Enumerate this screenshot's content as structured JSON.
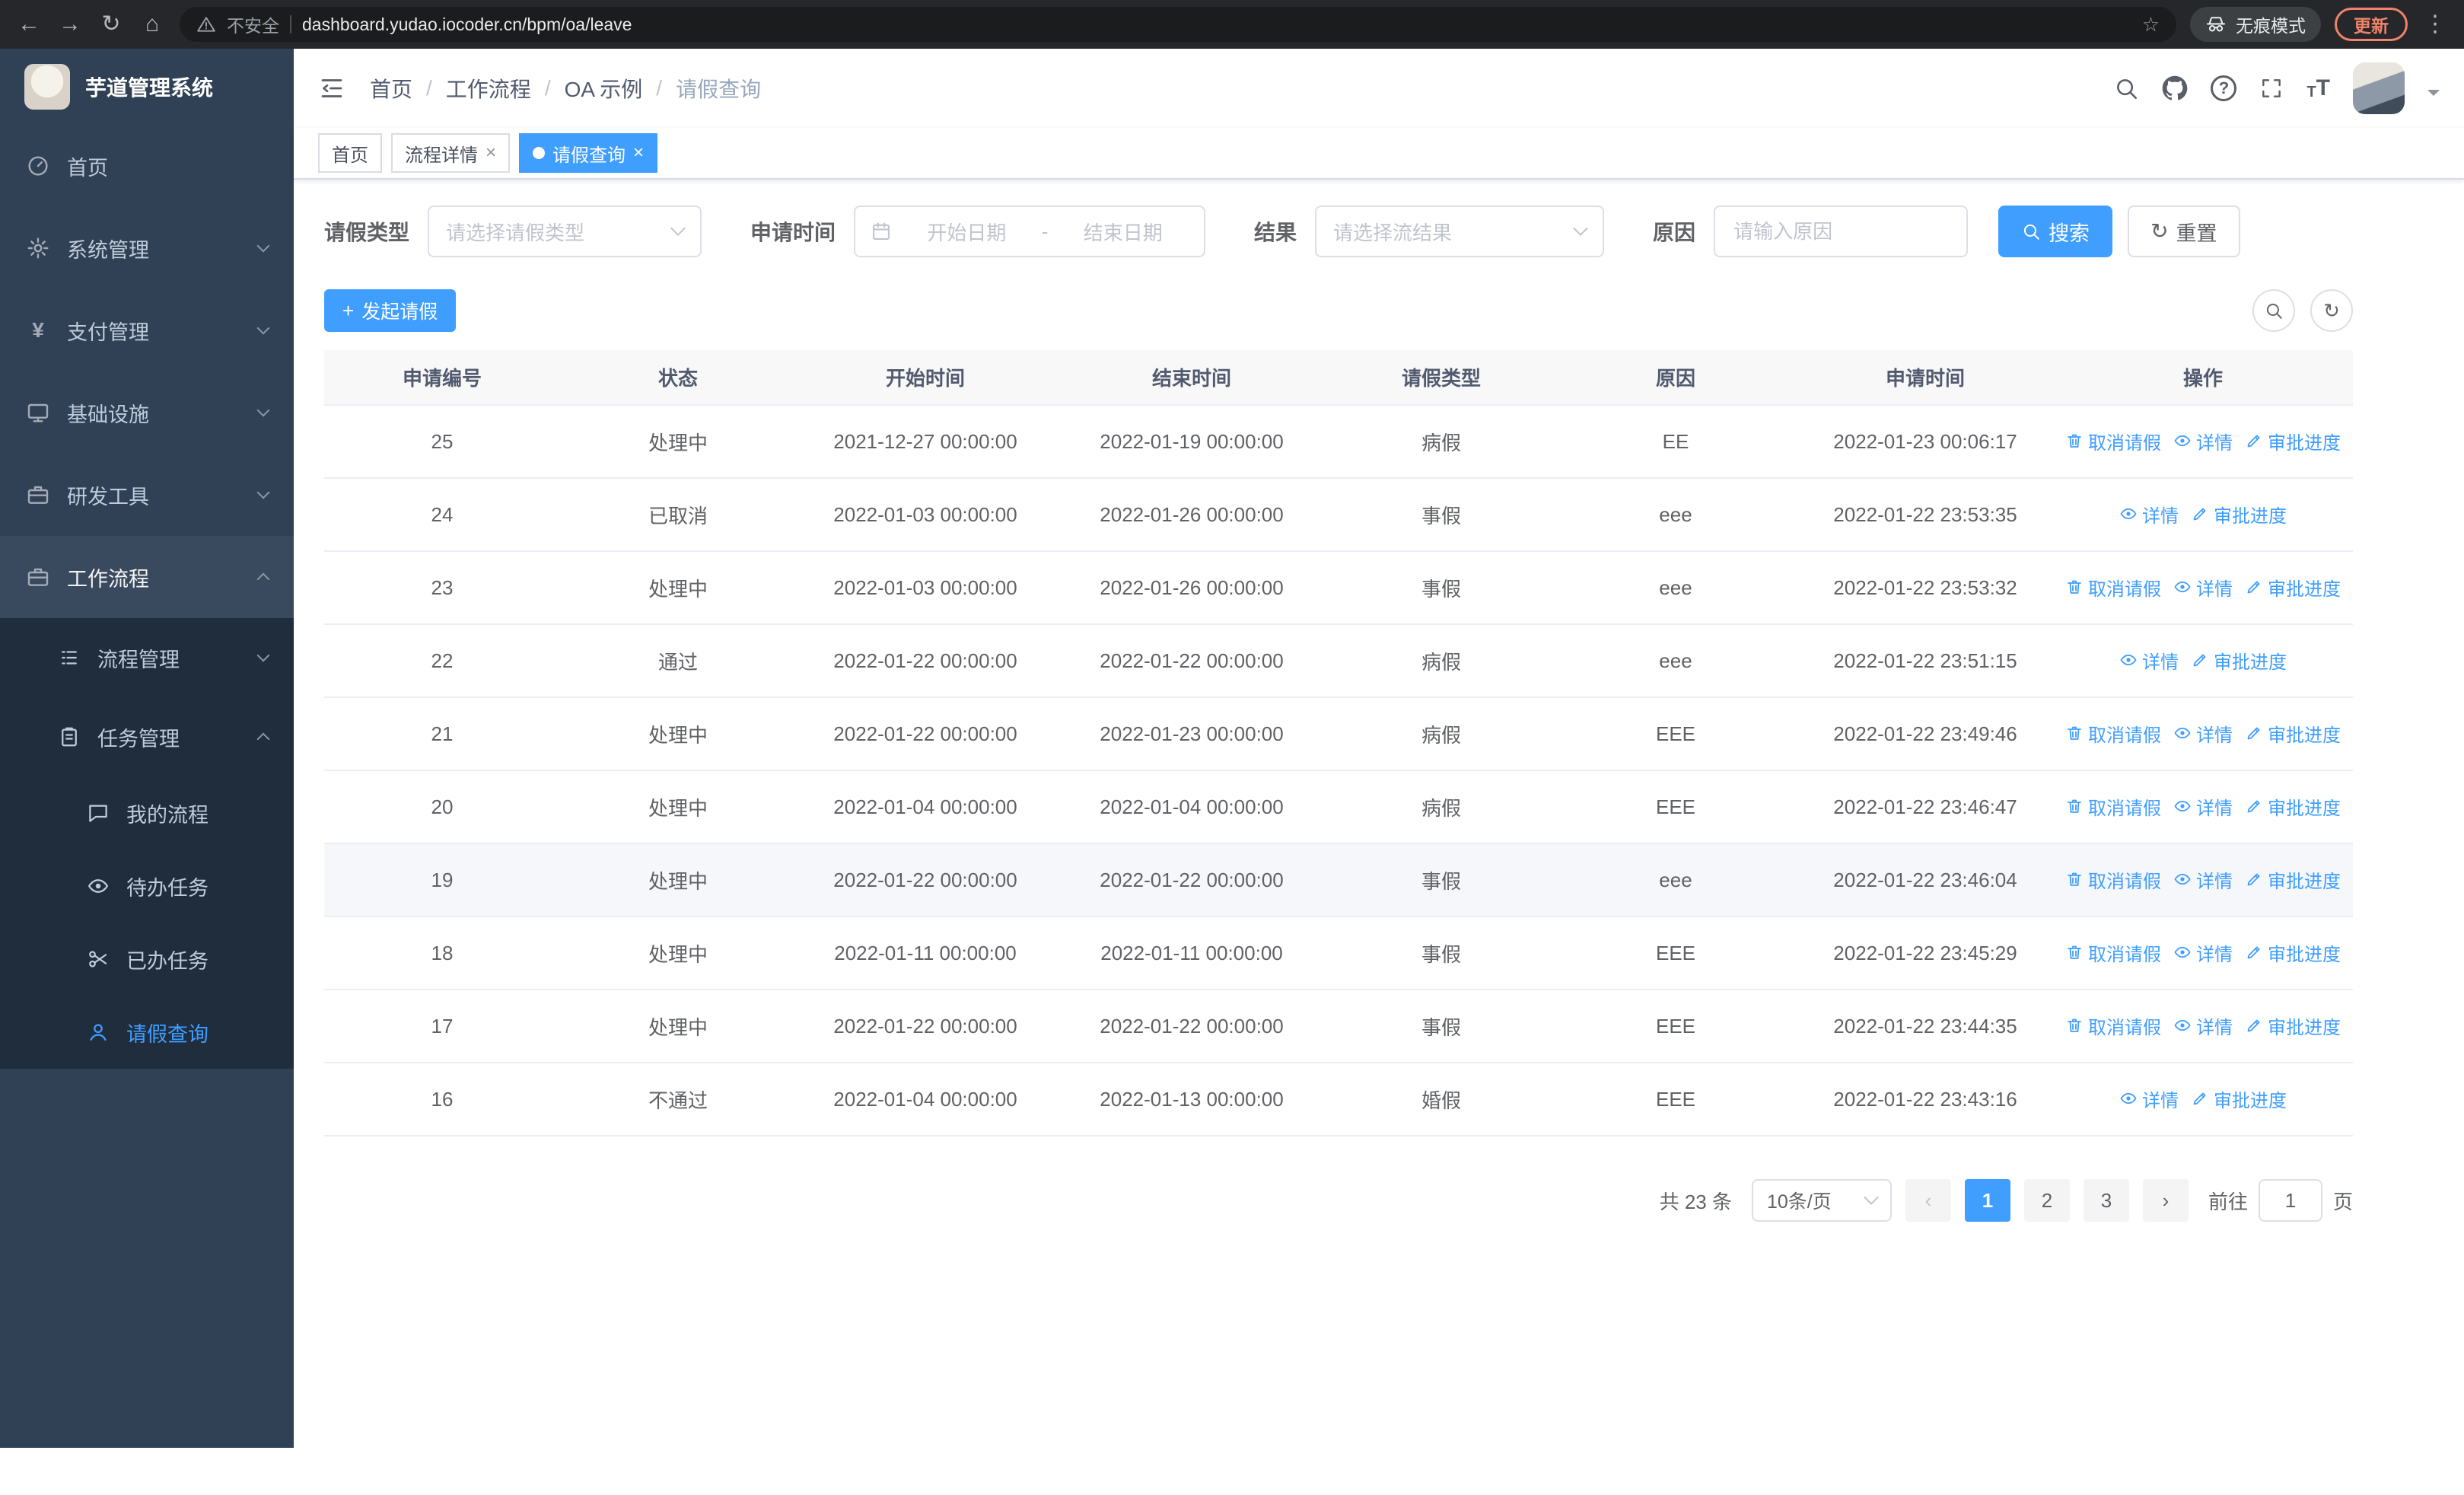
{
  "browser": {
    "security": "不安全",
    "url": "dashboard.yudao.iocoder.cn/bpm/oa/leave",
    "incognito": "无痕模式",
    "update": "更新"
  },
  "icons": {
    "back": "←",
    "forward": "→",
    "reload": "↻",
    "home": "⌂",
    "star": "☆",
    "menu_dots": "⋮",
    "close": "×",
    "plus": "+",
    "refresh": "↻",
    "chevron_prev": "‹",
    "chevron_next": "›",
    "yen": "¥",
    "question": "?",
    "letter_t": "T"
  },
  "sidebar": {
    "title": "芋道管理系统",
    "menu": [
      {
        "label": "首页"
      },
      {
        "label": "系统管理"
      },
      {
        "label": "支付管理"
      },
      {
        "label": "基础设施"
      },
      {
        "label": "研发工具"
      },
      {
        "label": "工作流程"
      }
    ],
    "workflow_children": [
      {
        "label": "流程管理"
      },
      {
        "label": "任务管理"
      }
    ],
    "task_children": [
      {
        "label": "我的流程"
      },
      {
        "label": "待办任务"
      },
      {
        "label": "已办任务"
      },
      {
        "label": "请假查询"
      }
    ]
  },
  "breadcrumb": {
    "separator": "/",
    "items": [
      "首页",
      "工作流程",
      "OA 示例",
      "请假查询"
    ]
  },
  "tabs": [
    {
      "label": "首页"
    },
    {
      "label": "流程详情"
    },
    {
      "label": "请假查询"
    }
  ],
  "filters": {
    "type_label": "请假类型",
    "type_placeholder": "请选择请假类型",
    "time_label": "申请时间",
    "start_placeholder": "开始日期",
    "range_separator": "-",
    "end_placeholder": "结束日期",
    "result_label": "结果",
    "result_placeholder": "请选择流结果",
    "reason_label": "原因",
    "reason_placeholder": "请输入原因",
    "search": "搜索",
    "reset": "重置"
  },
  "toolbar": {
    "create": "发起请假"
  },
  "table": {
    "columns": [
      "申请编号",
      "状态",
      "开始时间",
      "结束时间",
      "请假类型",
      "原因",
      "申请时间",
      "操作"
    ],
    "op_labels": {
      "cancel": "取消请假",
      "detail": "详情",
      "progress": "审批进度"
    },
    "rows": [
      {
        "id": "25",
        "status": "处理中",
        "start": "2021-12-27 00:00:00",
        "end": "2022-01-19 00:00:00",
        "type": "病假",
        "reason": "EE",
        "applied": "2022-01-23 00:06:17",
        "ops": [
          "cancel",
          "detail",
          "progress"
        ]
      },
      {
        "id": "24",
        "status": "已取消",
        "start": "2022-01-03 00:00:00",
        "end": "2022-01-26 00:00:00",
        "type": "事假",
        "reason": "eee",
        "applied": "2022-01-22 23:53:35",
        "ops": [
          "detail",
          "progress"
        ]
      },
      {
        "id": "23",
        "status": "处理中",
        "start": "2022-01-03 00:00:00",
        "end": "2022-01-26 00:00:00",
        "type": "事假",
        "reason": "eee",
        "applied": "2022-01-22 23:53:32",
        "ops": [
          "cancel",
          "detail",
          "progress"
        ]
      },
      {
        "id": "22",
        "status": "通过",
        "start": "2022-01-22 00:00:00",
        "end": "2022-01-22 00:00:00",
        "type": "病假",
        "reason": "eee",
        "applied": "2022-01-22 23:51:15",
        "ops": [
          "detail",
          "progress"
        ]
      },
      {
        "id": "21",
        "status": "处理中",
        "start": "2022-01-22 00:00:00",
        "end": "2022-01-23 00:00:00",
        "type": "病假",
        "reason": "EEE",
        "applied": "2022-01-22 23:49:46",
        "ops": [
          "cancel",
          "detail",
          "progress"
        ]
      },
      {
        "id": "20",
        "status": "处理中",
        "start": "2022-01-04 00:00:00",
        "end": "2022-01-04 00:00:00",
        "type": "病假",
        "reason": "EEE",
        "applied": "2022-01-22 23:46:47",
        "ops": [
          "cancel",
          "detail",
          "progress"
        ]
      },
      {
        "id": "19",
        "status": "处理中",
        "start": "2022-01-22 00:00:00",
        "end": "2022-01-22 00:00:00",
        "type": "事假",
        "reason": "eee",
        "applied": "2022-01-22 23:46:04",
        "ops": [
          "cancel",
          "detail",
          "progress"
        ],
        "hover": true
      },
      {
        "id": "18",
        "status": "处理中",
        "start": "2022-01-11 00:00:00",
        "end": "2022-01-11 00:00:00",
        "type": "事假",
        "reason": "EEE",
        "applied": "2022-01-22 23:45:29",
        "ops": [
          "cancel",
          "detail",
          "progress"
        ]
      },
      {
        "id": "17",
        "status": "处理中",
        "start": "2022-01-22 00:00:00",
        "end": "2022-01-22 00:00:00",
        "type": "事假",
        "reason": "EEE",
        "applied": "2022-01-22 23:44:35",
        "ops": [
          "cancel",
          "detail",
          "progress"
        ]
      },
      {
        "id": "16",
        "status": "不通过",
        "start": "2022-01-04 00:00:00",
        "end": "2022-01-13 00:00:00",
        "type": "婚假",
        "reason": "EEE",
        "applied": "2022-01-22 23:43:16",
        "ops": [
          "detail",
          "progress"
        ]
      }
    ]
  },
  "pagination": {
    "total": "共 23 条",
    "page_size": "10条/页",
    "pages": [
      "1",
      "2",
      "3"
    ],
    "active_page": "1",
    "goto_label": "前往",
    "goto_value": "1",
    "goto_suffix": "页"
  },
  "colors": {
    "primary": "#409eff",
    "sidebar_bg": "#304156",
    "submenu_bg": "#1f2d3d",
    "table_header_bg": "#f8f8f9"
  }
}
